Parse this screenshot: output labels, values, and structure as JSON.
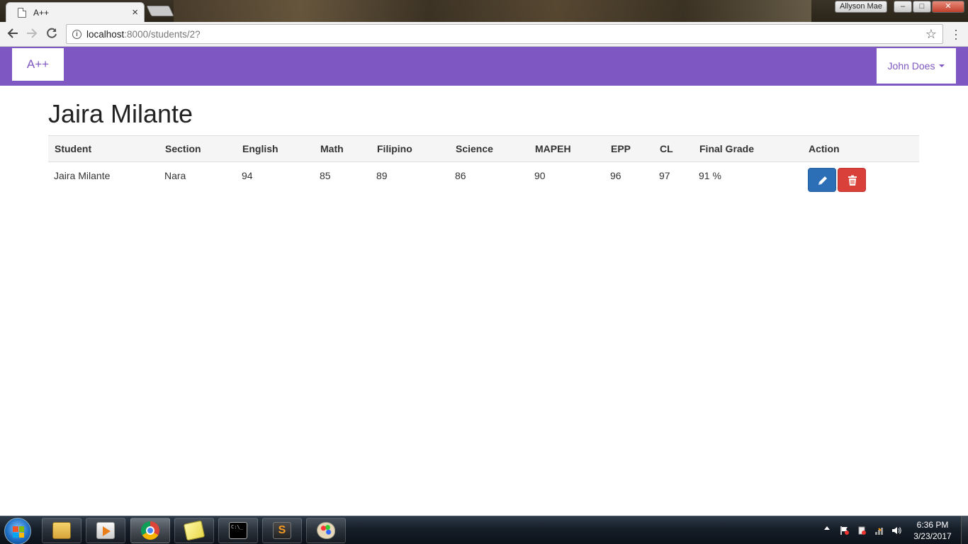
{
  "browser": {
    "tab_title": "A++",
    "tab_close": "×",
    "profile_name": "Allyson Mae",
    "url_host": "localhost",
    "url_path": ":8000/students/2?",
    "minimize": "–",
    "maximize": "□",
    "close": "✕"
  },
  "navbar": {
    "brand": "A++",
    "user_name": "John Does"
  },
  "page": {
    "title": "Jaira Milante"
  },
  "table": {
    "headers": [
      "Student",
      "Section",
      "English",
      "Math",
      "Filipino",
      "Science",
      "MAPEH",
      "EPP",
      "CL",
      "Final Grade",
      "Action"
    ],
    "rows": [
      {
        "student": "Jaira Milante",
        "section": "Nara",
        "english": "94",
        "math": "85",
        "filipino": "89",
        "science": "86",
        "mapeh": "90",
        "epp": "96",
        "cl": "97",
        "final_grade": "91 %"
      }
    ]
  },
  "taskbar": {
    "time": "6:36 PM",
    "date": "3/23/2017",
    "cmd_label": "C:\\_"
  },
  "colors": {
    "navbar": "#7e57c2",
    "edit_button": "#2d6fb6",
    "delete_button": "#d9403a"
  },
  "icons": [
    "pencil-icon",
    "trash-icon",
    "star-icon",
    "info-icon",
    "back-arrow-icon",
    "forward-arrow-icon",
    "reload-icon"
  ]
}
